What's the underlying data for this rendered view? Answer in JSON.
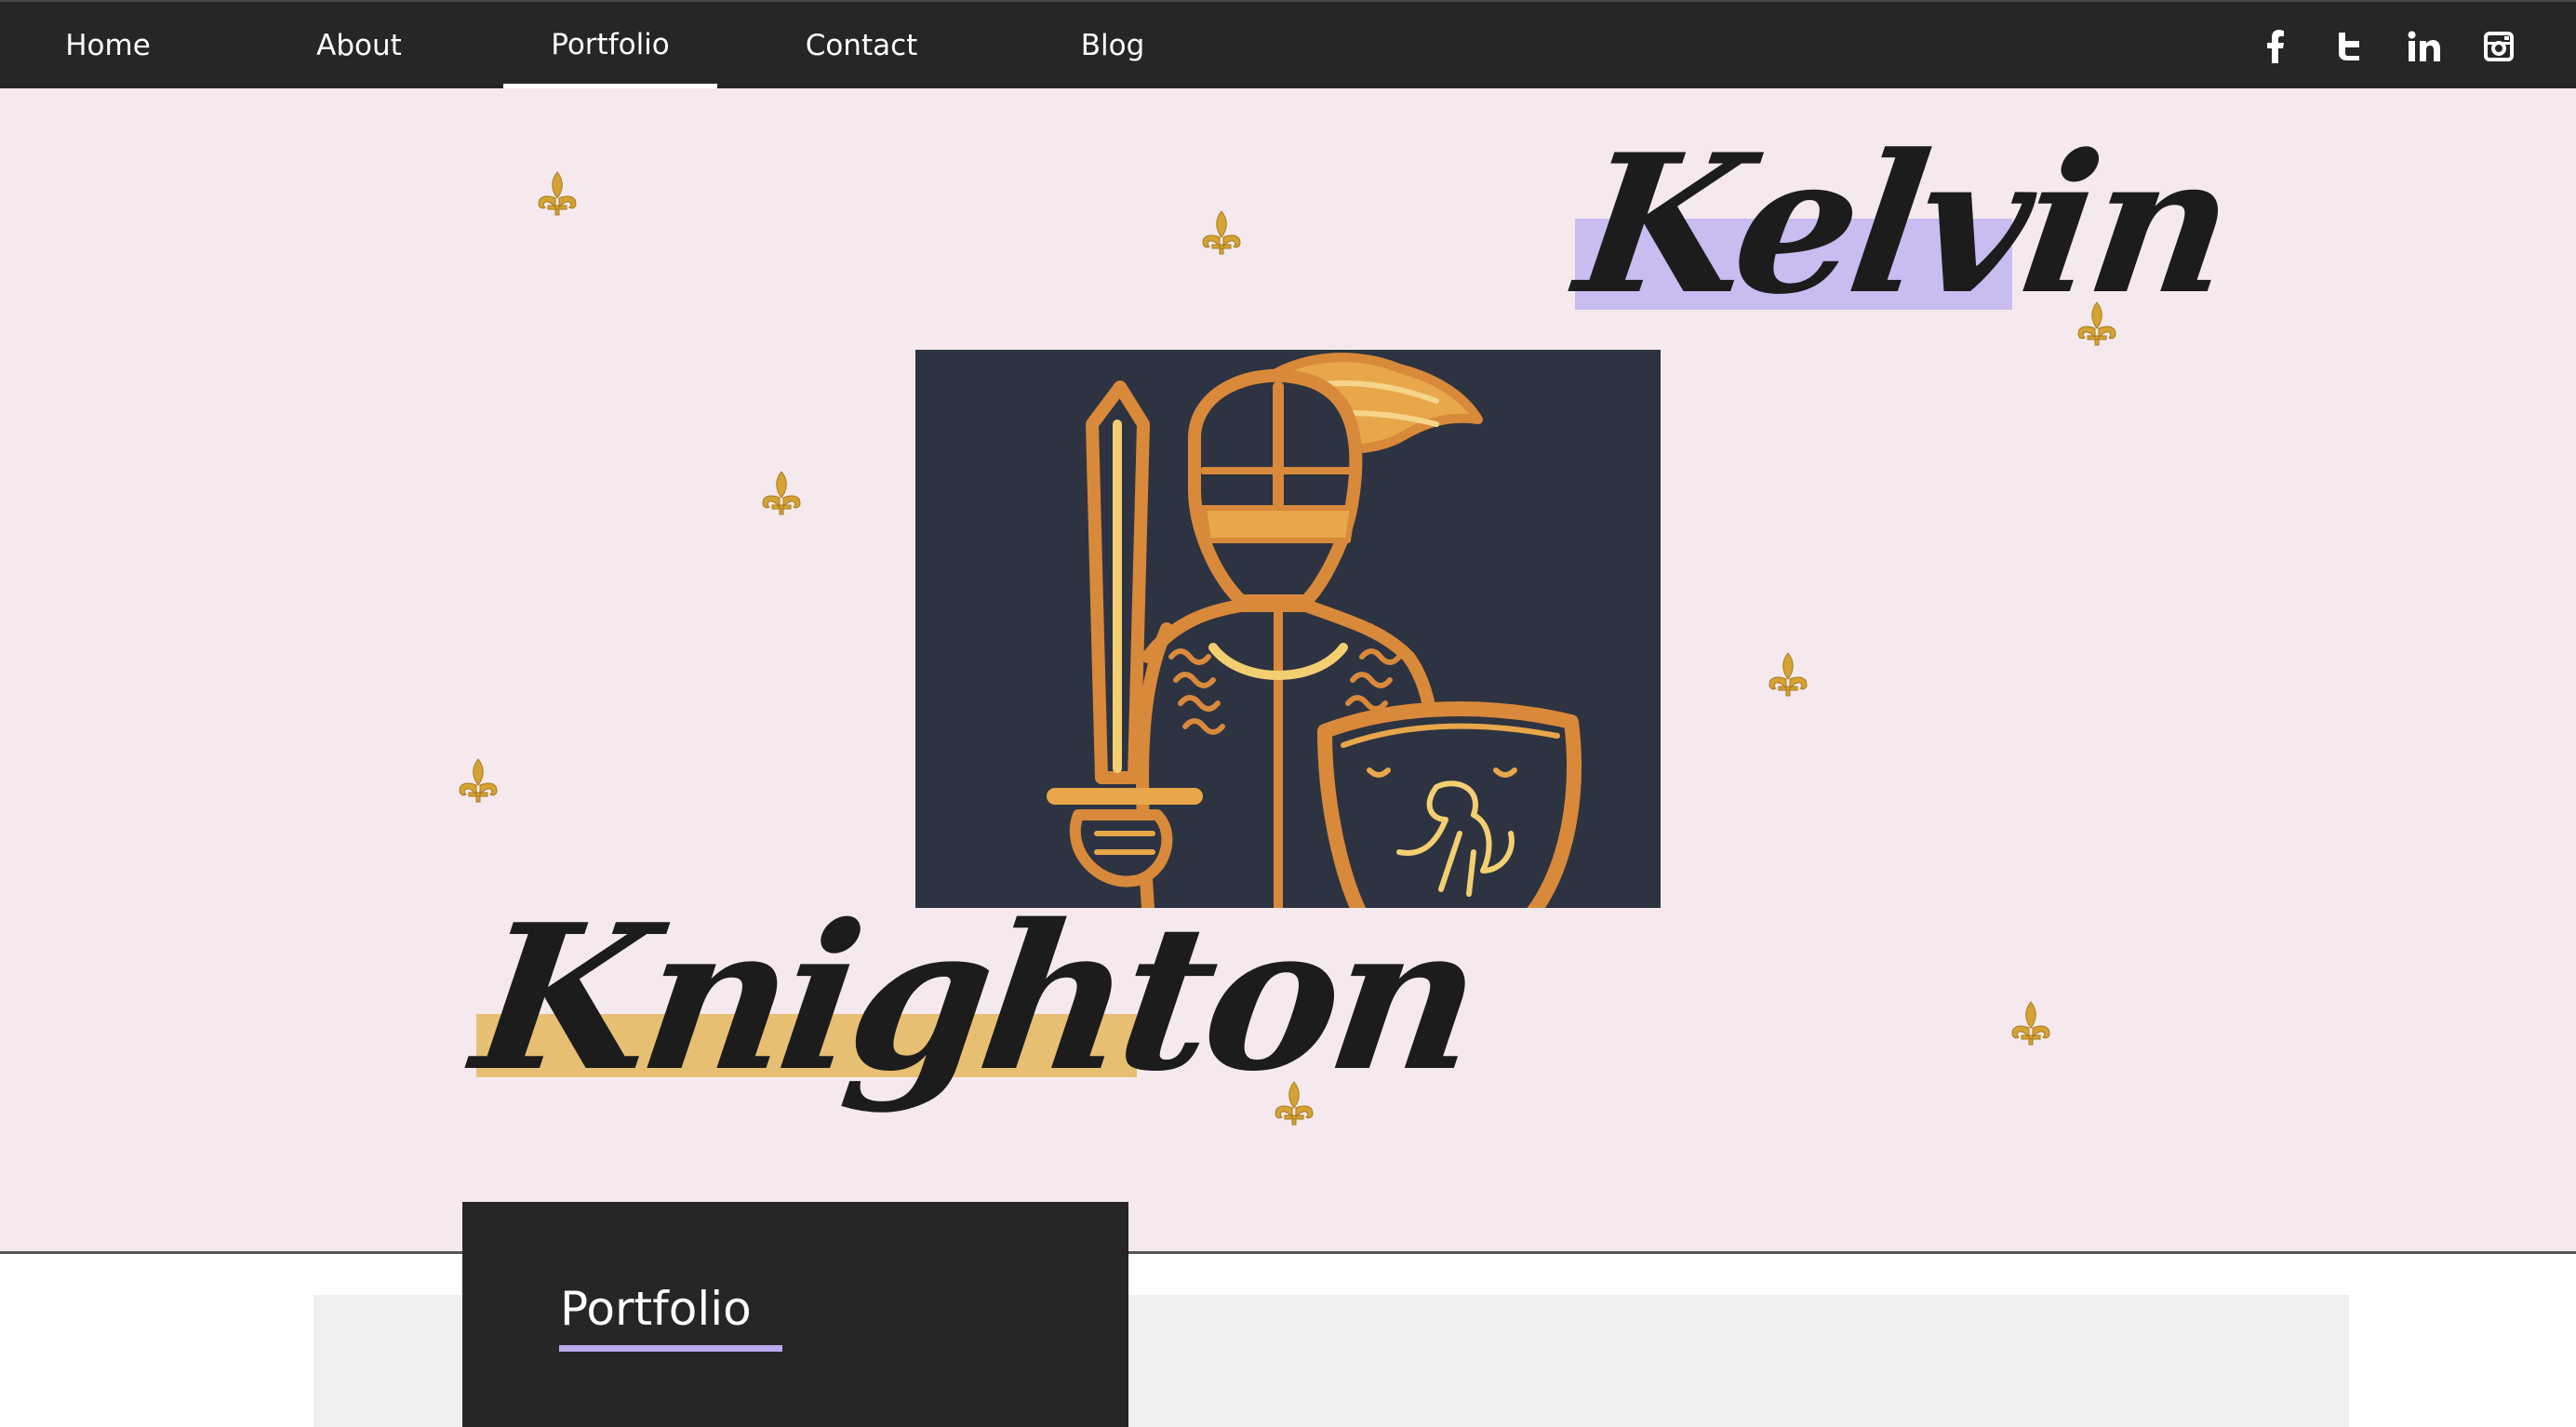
{
  "nav": {
    "items": [
      {
        "label": "Home"
      },
      {
        "label": "About"
      },
      {
        "label": "Portfolio",
        "active": true
      },
      {
        "label": "Contact"
      },
      {
        "label": "Blog"
      }
    ],
    "social": [
      "facebook-icon",
      "twitter-icon",
      "linkedin-icon",
      "instagram-icon"
    ]
  },
  "hero": {
    "first_name": "Kelvin",
    "last_name": "Knighton",
    "image": "knight-illustration",
    "decoration": "fleur-de-lis"
  },
  "section": {
    "title": "Portfolio"
  },
  "colors": {
    "nav_bg": "#262626",
    "hero_bg": "#f5e9ee",
    "highlight_purple": "#c9bcf0",
    "highlight_gold": "#e6bf72",
    "gold": "#d4a334",
    "image_bg": "#2e3341",
    "knight_orange": "#d9893a"
  }
}
